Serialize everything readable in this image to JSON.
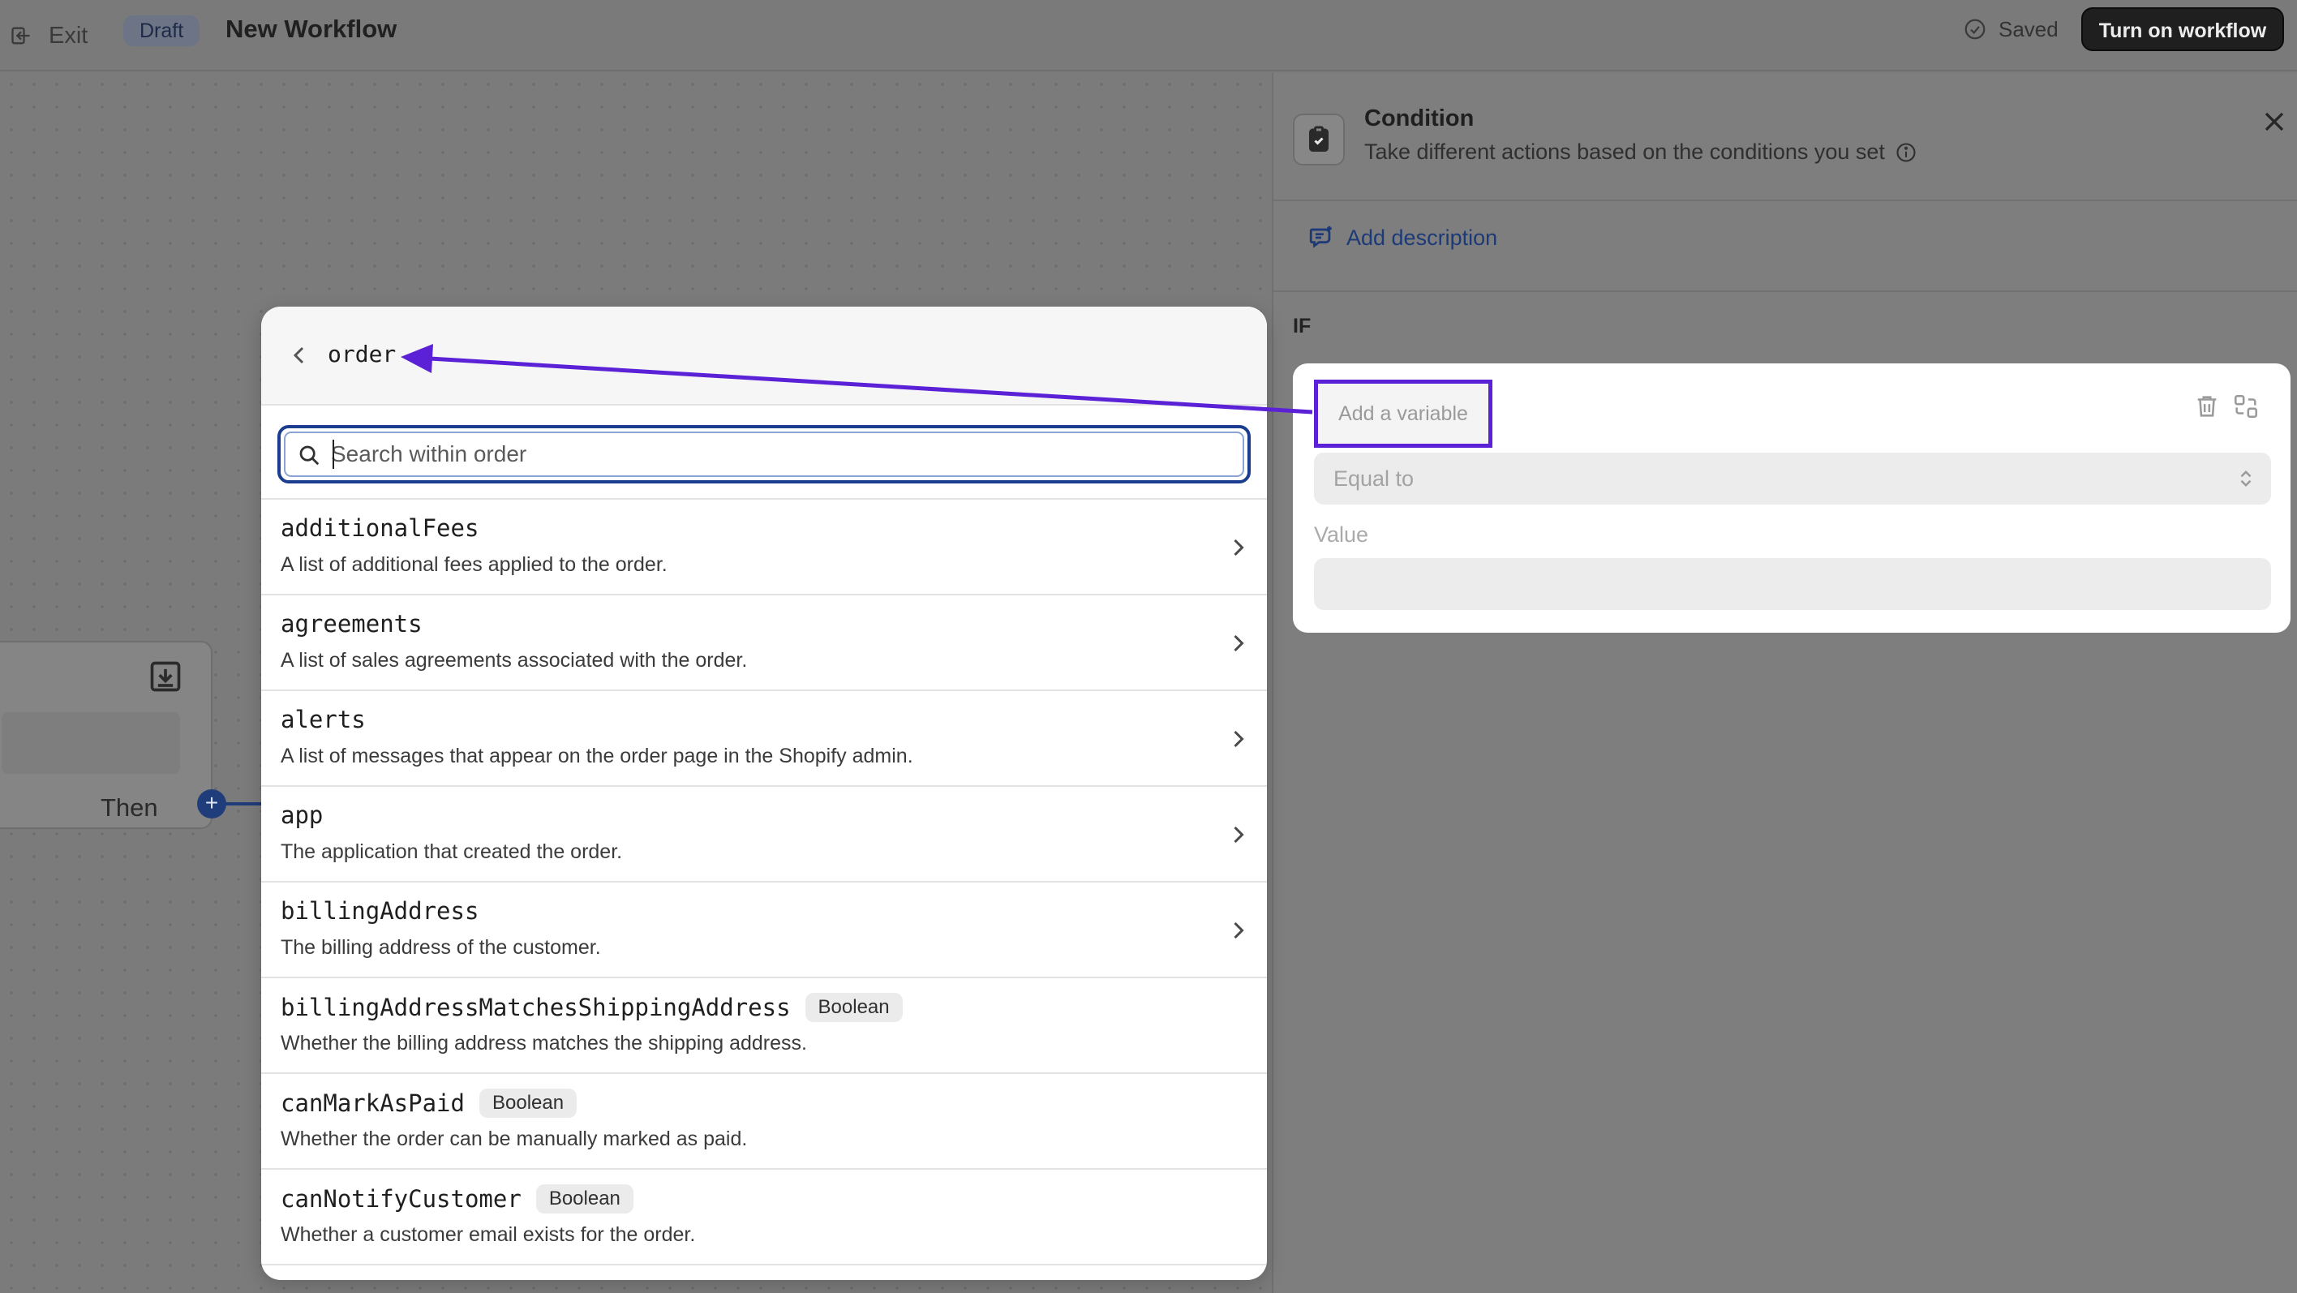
{
  "topbar": {
    "exit_label": "Exit",
    "draft_label": "Draft",
    "title": "New Workflow",
    "saved_label": "Saved",
    "turn_on_label": "Turn on workflow"
  },
  "canvas": {
    "node_then_label": "Then",
    "plus_symbol": "+"
  },
  "panel": {
    "title": "Condition",
    "subtitle": "Take different actions based on the conditions you set",
    "add_description": "Add description",
    "if_label": "IF",
    "variable_placeholder": "Add a variable",
    "operator_value": "Equal to",
    "value_label": "Value",
    "value_input": ""
  },
  "popover": {
    "title": "order",
    "search_placeholder": "Search within order",
    "items": [
      {
        "name": "additionalFees",
        "desc": "A list of additional fees applied to the order.",
        "badge": "",
        "has_children": true
      },
      {
        "name": "agreements",
        "desc": "A list of sales agreements associated with the order.",
        "badge": "",
        "has_children": true
      },
      {
        "name": "alerts",
        "desc": "A list of messages that appear on the order page in the Shopify admin.",
        "badge": "",
        "has_children": true
      },
      {
        "name": "app",
        "desc": "The application that created the order.",
        "badge": "",
        "has_children": true
      },
      {
        "name": "billingAddress",
        "desc": "The billing address of the customer.",
        "badge": "",
        "has_children": true
      },
      {
        "name": "billingAddressMatchesShippingAddress",
        "desc": "Whether the billing address matches the shipping address.",
        "badge": "Boolean",
        "has_children": false
      },
      {
        "name": "canMarkAsPaid",
        "desc": "Whether the order can be manually marked as paid.",
        "badge": "Boolean",
        "has_children": false
      },
      {
        "name": "canNotifyCustomer",
        "desc": "Whether a customer email exists for the order.",
        "badge": "Boolean",
        "has_children": false
      }
    ]
  },
  "colors": {
    "annotation": "#5b21d6",
    "primary_blue": "#1a3d8f",
    "overlay_gray": "#7b7b7b"
  },
  "icons": [
    "exit-icon",
    "check-circle-icon",
    "download-icon",
    "zoom-out-icon",
    "zoom-in-icon",
    "fit-view-icon",
    "help-icon",
    "clipboard-check-icon",
    "info-icon",
    "close-icon",
    "comment-icon",
    "trash-icon",
    "swap-icon",
    "chevron-updown-icon",
    "chevron-left-icon",
    "search-icon",
    "chevron-right-icon"
  ]
}
